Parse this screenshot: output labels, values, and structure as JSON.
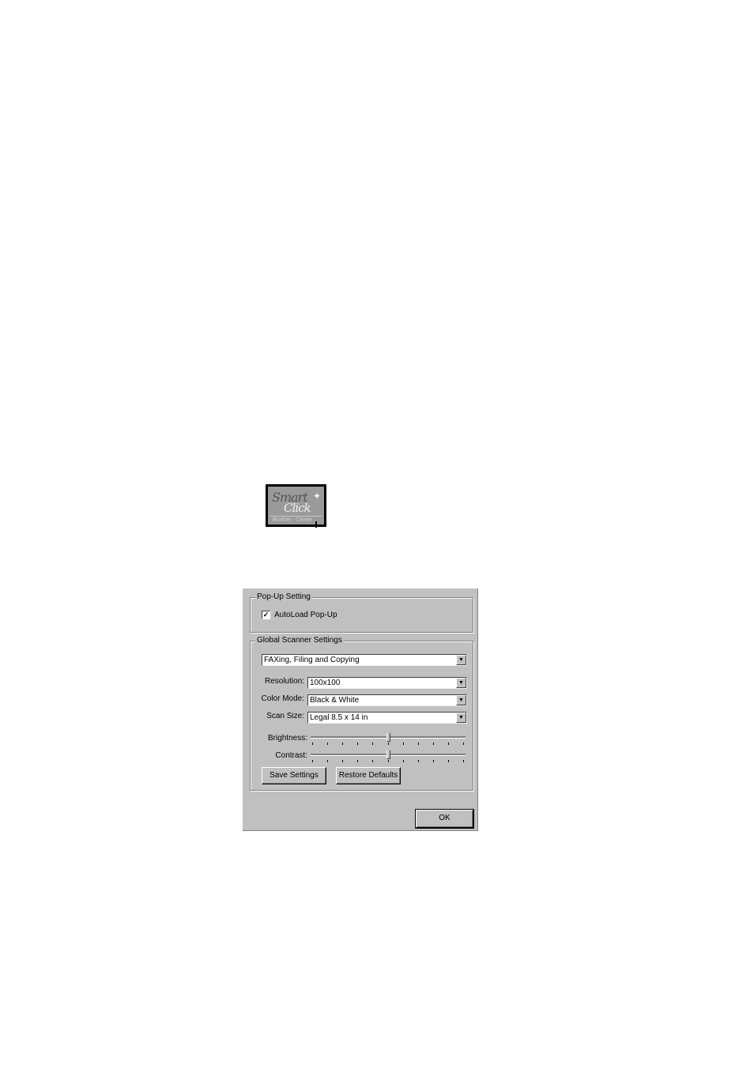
{
  "logo": {
    "word1": "Smart",
    "word2": "Click",
    "subtitle": "Brother · Center"
  },
  "dialog": {
    "popup_group": {
      "title": "Pop-Up Setting",
      "autoload": {
        "label": "AutoLoad Pop-Up",
        "checked": true,
        "mark": "✓"
      }
    },
    "scanner_group": {
      "title": "Global Scanner Settings",
      "profile": "FAXing, Filing and Copying",
      "resolution": {
        "label": "Resolution:",
        "value": "100x100"
      },
      "color_mode": {
        "label": "Color Mode:",
        "value": "Black & White"
      },
      "scan_size": {
        "label": "Scan Size:",
        "value": "Legal 8.5 x 14 in"
      },
      "brightness": {
        "label": "Brightness:",
        "level": 0.5
      },
      "contrast": {
        "label": "Contrast:",
        "level": 0.5
      },
      "save_button": "Save Settings",
      "restore_button": "Restore Defaults"
    },
    "ok_button": "OK",
    "dropdown_arrow": "▼"
  }
}
